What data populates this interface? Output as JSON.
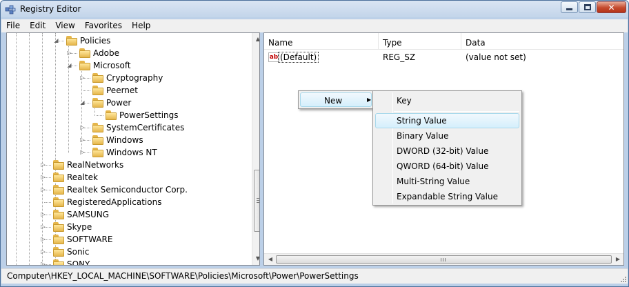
{
  "window": {
    "title": "Registry Editor",
    "min_icon": "minimize-icon",
    "max_icon": "maximize-icon",
    "close_icon": "close-icon",
    "close_glyph": "✕"
  },
  "menubar": {
    "items": [
      "File",
      "Edit",
      "View",
      "Favorites",
      "Help"
    ]
  },
  "tree": {
    "items": [
      {
        "label": "Policies",
        "expander": "◢",
        "icon": "folder-icon"
      },
      {
        "label": "Adobe",
        "expander": "▷",
        "icon": "folder-icon"
      },
      {
        "label": "Microsoft",
        "expander": "◢",
        "icon": "folder-icon"
      },
      {
        "label": "Cryptography",
        "expander": "▷",
        "icon": "folder-icon"
      },
      {
        "label": "Peernet",
        "expander": "",
        "icon": "folder-icon"
      },
      {
        "label": "Power",
        "expander": "◢",
        "icon": "folder-icon"
      },
      {
        "label": "PowerSettings",
        "expander": "",
        "icon": "folder-open-icon"
      },
      {
        "label": "SystemCertificates",
        "expander": "▷",
        "icon": "folder-icon"
      },
      {
        "label": "Windows",
        "expander": "▷",
        "icon": "folder-icon"
      },
      {
        "label": "Windows NT",
        "expander": "▷",
        "icon": "folder-icon"
      },
      {
        "label": "RealNetworks",
        "expander": "▷",
        "icon": "folder-icon"
      },
      {
        "label": "Realtek",
        "expander": "▷",
        "icon": "folder-icon"
      },
      {
        "label": "Realtek Semiconductor Corp.",
        "expander": "▷",
        "icon": "folder-icon"
      },
      {
        "label": "RegisteredApplications",
        "expander": "",
        "icon": "folder-icon"
      },
      {
        "label": "SAMSUNG",
        "expander": "▷",
        "icon": "folder-icon"
      },
      {
        "label": "Skype",
        "expander": "▷",
        "icon": "folder-icon"
      },
      {
        "label": "SOFTWARE",
        "expander": "▷",
        "icon": "folder-icon"
      },
      {
        "label": "Sonic",
        "expander": "▷",
        "icon": "folder-icon"
      },
      {
        "label": "SONY",
        "expander": "▷",
        "icon": "folder-icon"
      }
    ],
    "scroll_up": "▲",
    "scroll_down": "▼"
  },
  "list": {
    "columns": [
      "Name",
      "Type",
      "Data"
    ],
    "rows": [
      {
        "icon": "string-value-icon",
        "icon_text": "ab",
        "name": "(Default)",
        "type": "REG_SZ",
        "data": "(value not set)"
      }
    ],
    "scroll_left": "◀",
    "scroll_right": "▶"
  },
  "context_menu": {
    "new_label": "New",
    "new_arrow": "▶",
    "submenu": [
      "Key",
      "String Value",
      "Binary Value",
      "DWORD (32-bit) Value",
      "QWORD (64-bit) Value",
      "Multi-String Value",
      "Expandable String Value"
    ],
    "highlighted": "String Value"
  },
  "statusbar": {
    "path": "Computer\\HKEY_LOCAL_MACHINE\\SOFTWARE\\Policies\\Microsoft\\Power\\PowerSettings"
  }
}
